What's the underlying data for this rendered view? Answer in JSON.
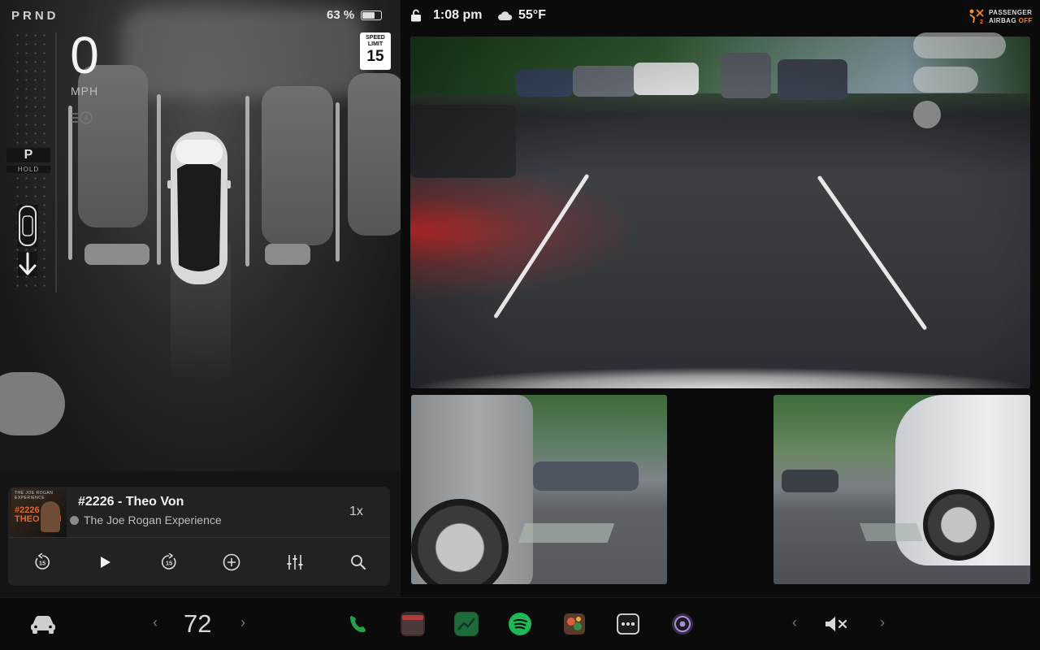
{
  "left": {
    "gears": "PRND",
    "battery_percent": "63 %",
    "battery_level": 0.63,
    "speed": "0",
    "speed_unit": "MPH",
    "speed_limit_label": "SPEED LIMIT",
    "speed_limit_value": "15",
    "current_gear": "P",
    "hold_label": "HOLD"
  },
  "media": {
    "art_header": "THE JOE ROGAN EXPERIENCE",
    "art_text": "#2226 THEO VON",
    "title": "#2226 - Theo Von",
    "show": "The Joe Rogan Experience",
    "playback_rate": "1x",
    "controls": [
      "rewind-15-icon",
      "play-icon",
      "forward-15-icon",
      "add-icon",
      "equalizer-icon",
      "search-icon"
    ]
  },
  "status": {
    "time": "1:08 pm",
    "temperature": "55°F",
    "airbag_line1": "PASSENGER",
    "airbag_line2": "AIRBAG",
    "airbag_state": "OFF"
  },
  "dock": {
    "cabin_temp": "72",
    "left_chevron": "‹",
    "right_chevron": "›",
    "apps": [
      "phone-icon",
      "calendar-icon",
      "toybox-icon",
      "spotify-icon",
      "arcade-icon",
      "more-icon",
      "camera-app-icon"
    ],
    "colors": {
      "phone": "#27a04a",
      "spotify": "#1db954",
      "airbag_off": "#f08a2b"
    }
  }
}
